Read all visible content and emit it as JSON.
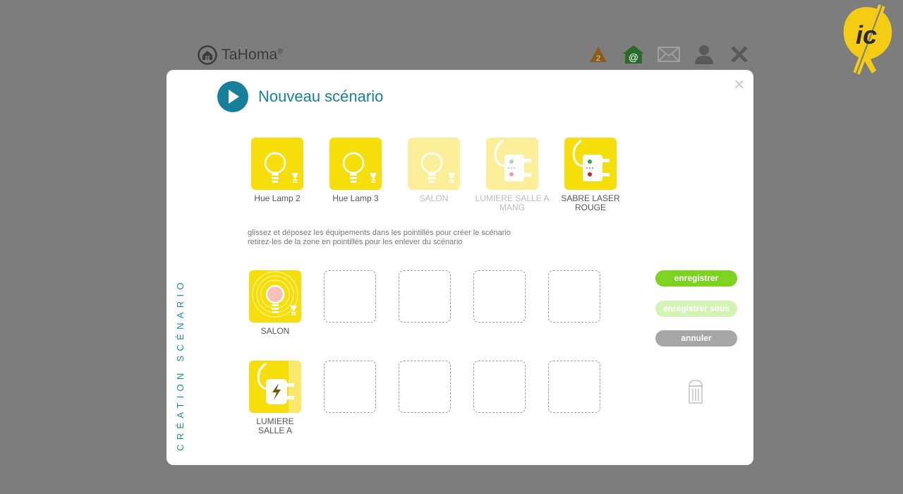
{
  "brand": {
    "name": "TaHoma",
    "reg": "®"
  },
  "top_icons": [
    {
      "name": "alert-icon",
      "badge": "2",
      "color": "#8a5a1e"
    },
    {
      "name": "home-at-icon",
      "color": "#2a6b2a"
    },
    {
      "name": "mail-icon",
      "color": "#a0a0a0"
    },
    {
      "name": "user-icon",
      "color": "#5a5a5a"
    },
    {
      "name": "close-icon",
      "color": "#5a5a5a"
    }
  ],
  "modal": {
    "title": "Nouveau scénario",
    "side_label": "CRÉATION SCÉNARIO",
    "close": "×",
    "devices": [
      {
        "label": "Hue Lamp 2",
        "type": "lamp",
        "faded": false
      },
      {
        "label": "Hue Lamp 3",
        "type": "lamp",
        "faded": false
      },
      {
        "label": "SALON",
        "type": "lamp",
        "faded": true
      },
      {
        "label": "LUMIERE SALLE A MANG",
        "type": "plug",
        "faded": true
      },
      {
        "label": "SABRE LASER ROUGE",
        "type": "plug",
        "faded": false
      }
    ],
    "hint_line1": "glissez et déposez les équipements dans les pointillés pour créer le scénario",
    "hint_line2": "retirez-les de la zone en pointillés pour les enlever du scénario",
    "scenario_items": [
      {
        "label": "SALON",
        "type": "lamp-active"
      },
      {
        "label": "LUMIERE SALLE A",
        "type": "plug-active"
      }
    ],
    "buttons": {
      "save": "enregistrer",
      "save_as": "enregistrer sous",
      "cancel": "annuler"
    }
  },
  "colors": {
    "accent": "#16809c",
    "tile_yellow": "#f6de09",
    "save_green": "#7ed321"
  }
}
